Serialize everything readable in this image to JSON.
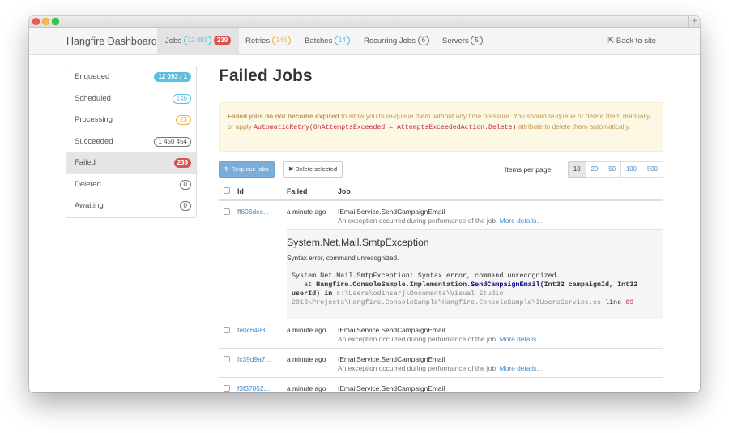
{
  "nav": {
    "brand": "Hangfire Dashboard",
    "items": [
      {
        "label": "Jobs",
        "badge": "12 093",
        "badge2": "239"
      },
      {
        "label": "Retries",
        "badge": "146"
      },
      {
        "label": "Batches",
        "badge": "14"
      },
      {
        "label": "Recurring Jobs",
        "badge": "6"
      },
      {
        "label": "Servers",
        "badge": "5"
      }
    ],
    "back_icon": "⇱",
    "back": "Back to site"
  },
  "sidebar": [
    {
      "label": "Enqueued",
      "badge": "12 093 / 1"
    },
    {
      "label": "Scheduled",
      "badge": "146"
    },
    {
      "label": "Processing",
      "badge": "23"
    },
    {
      "label": "Succeeded",
      "badge": "1 450 454"
    },
    {
      "label": "Failed",
      "badge": "239"
    },
    {
      "label": "Deleted",
      "badge": "0"
    },
    {
      "label": "Awaiting",
      "badge": "0"
    }
  ],
  "page": {
    "title": "Failed Jobs",
    "alert_bold": "Failed jobs do not become expired",
    "alert_text1": " to allow you to re-queue them without any time pressure. You should re-queue or delete them manually, or apply ",
    "alert_code": "AutomaticRetry(OnAttemptsExceeded = AttemptsExceededAction.Delete)",
    "alert_text2": " attribute to delete them automatically."
  },
  "toolbar": {
    "requeue_icon": "↻",
    "requeue": "Requeue jobs",
    "delete_icon": "✖",
    "delete": "Delete selected",
    "ipp_label": "Items per page:",
    "page_sizes": [
      "10",
      "20",
      "50",
      "100",
      "500"
    ]
  },
  "table": {
    "headers": {
      "id": "Id",
      "failed": "Failed",
      "job": "Job"
    },
    "rows": [
      {
        "id": "ff606dec...",
        "failed": "a minute ago",
        "job": "IEmailService.SendCampaignEmail",
        "sub": "An exception occurred during performance of the job.",
        "more": "More details..."
      },
      {
        "id": "fe0c6493...",
        "failed": "a minute ago",
        "job": "IEmailService.SendCampaignEmail",
        "sub": "An exception occurred during performance of the job.",
        "more": "More details..."
      },
      {
        "id": "fc39d9a7...",
        "failed": "a minute ago",
        "job": "IEmailService.SendCampaignEmail",
        "sub": "An exception occurred during performance of the job.",
        "more": "More details..."
      },
      {
        "id": "f3f37052...",
        "failed": "a minute ago",
        "job": "IEmailService.SendCampaignEmail"
      }
    ],
    "exception": {
      "title": "System.Net.Mail.SmtpException",
      "message": "Syntax error, command unrecognized.",
      "stack_line1": "System.Net.Mail.SmtpException: Syntax error, command unrecognized.",
      "stack_at": "   at ",
      "stack_ns": "Hangfire.ConsoleSample.Implementation.",
      "stack_fn": "SendCampaignEmail",
      "stack_args": "(Int32 campaignId, Int32 userId) in ",
      "stack_path": "c:\\Users\\odinserj\\Documents\\Visual Studio 2013\\Projects\\Hangfire.ConsoleSample\\Hangfire.ConsoleSample\\IUsersService.cs",
      "stack_line_label": ":line ",
      "stack_line_no": "69"
    }
  }
}
